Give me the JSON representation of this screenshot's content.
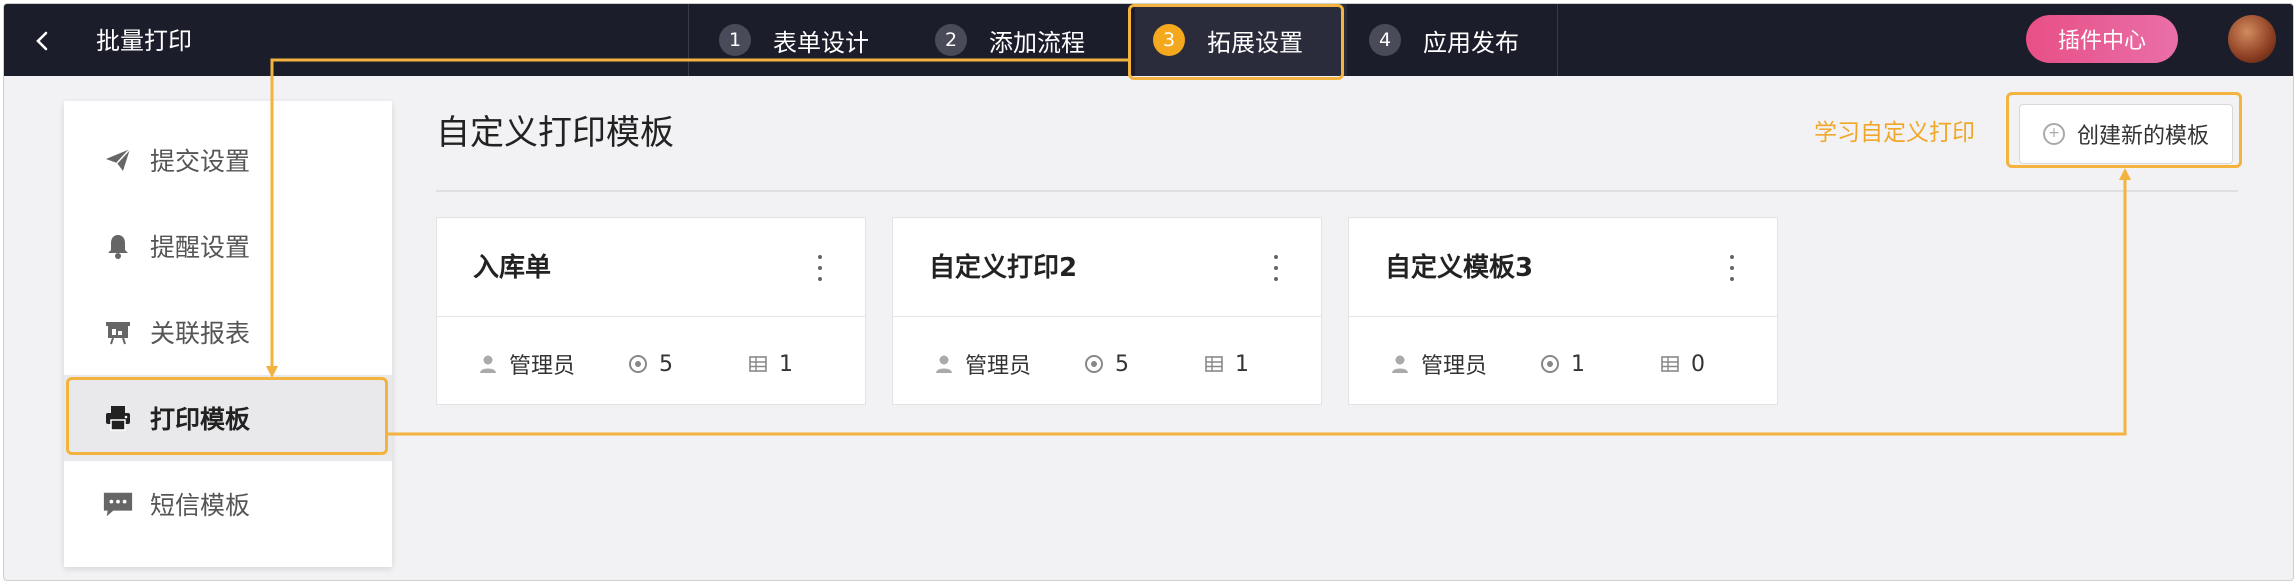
{
  "header": {
    "back_label": "<",
    "app_title": "批量打印",
    "steps": [
      {
        "num": "1",
        "label": "表单设计"
      },
      {
        "num": "2",
        "label": "添加流程"
      },
      {
        "num": "3",
        "label": "拓展设置"
      },
      {
        "num": "4",
        "label": "应用发布"
      }
    ],
    "active_step": 3,
    "plugin_center_label": "插件中心"
  },
  "sidebar": {
    "items": [
      {
        "label": "提交设置",
        "icon": "send-icon"
      },
      {
        "label": "提醒设置",
        "icon": "bell-icon"
      },
      {
        "label": "关联报表",
        "icon": "report-icon"
      },
      {
        "label": "打印模板",
        "icon": "printer-icon"
      },
      {
        "label": "短信模板",
        "icon": "message-icon"
      }
    ],
    "active_index": 3
  },
  "main": {
    "title": "自定义打印模板",
    "learn_link": "学习自定义打印",
    "new_template_label": "创建新的模板",
    "cards": [
      {
        "title": "入库单",
        "owner": "管理员",
        "count_a": "5",
        "count_b": "1"
      },
      {
        "title": "自定义打印2",
        "owner": "管理员",
        "count_a": "5",
        "count_b": "1"
      },
      {
        "title": "自定义模板3",
        "owner": "管理员",
        "count_a": "1",
        "count_b": "0"
      }
    ]
  },
  "colors": {
    "topbar": "#1c1d2b",
    "accent_orange": "#f3a81e",
    "plugin_button": "#e84f86",
    "annotation": "#f4b23e"
  }
}
